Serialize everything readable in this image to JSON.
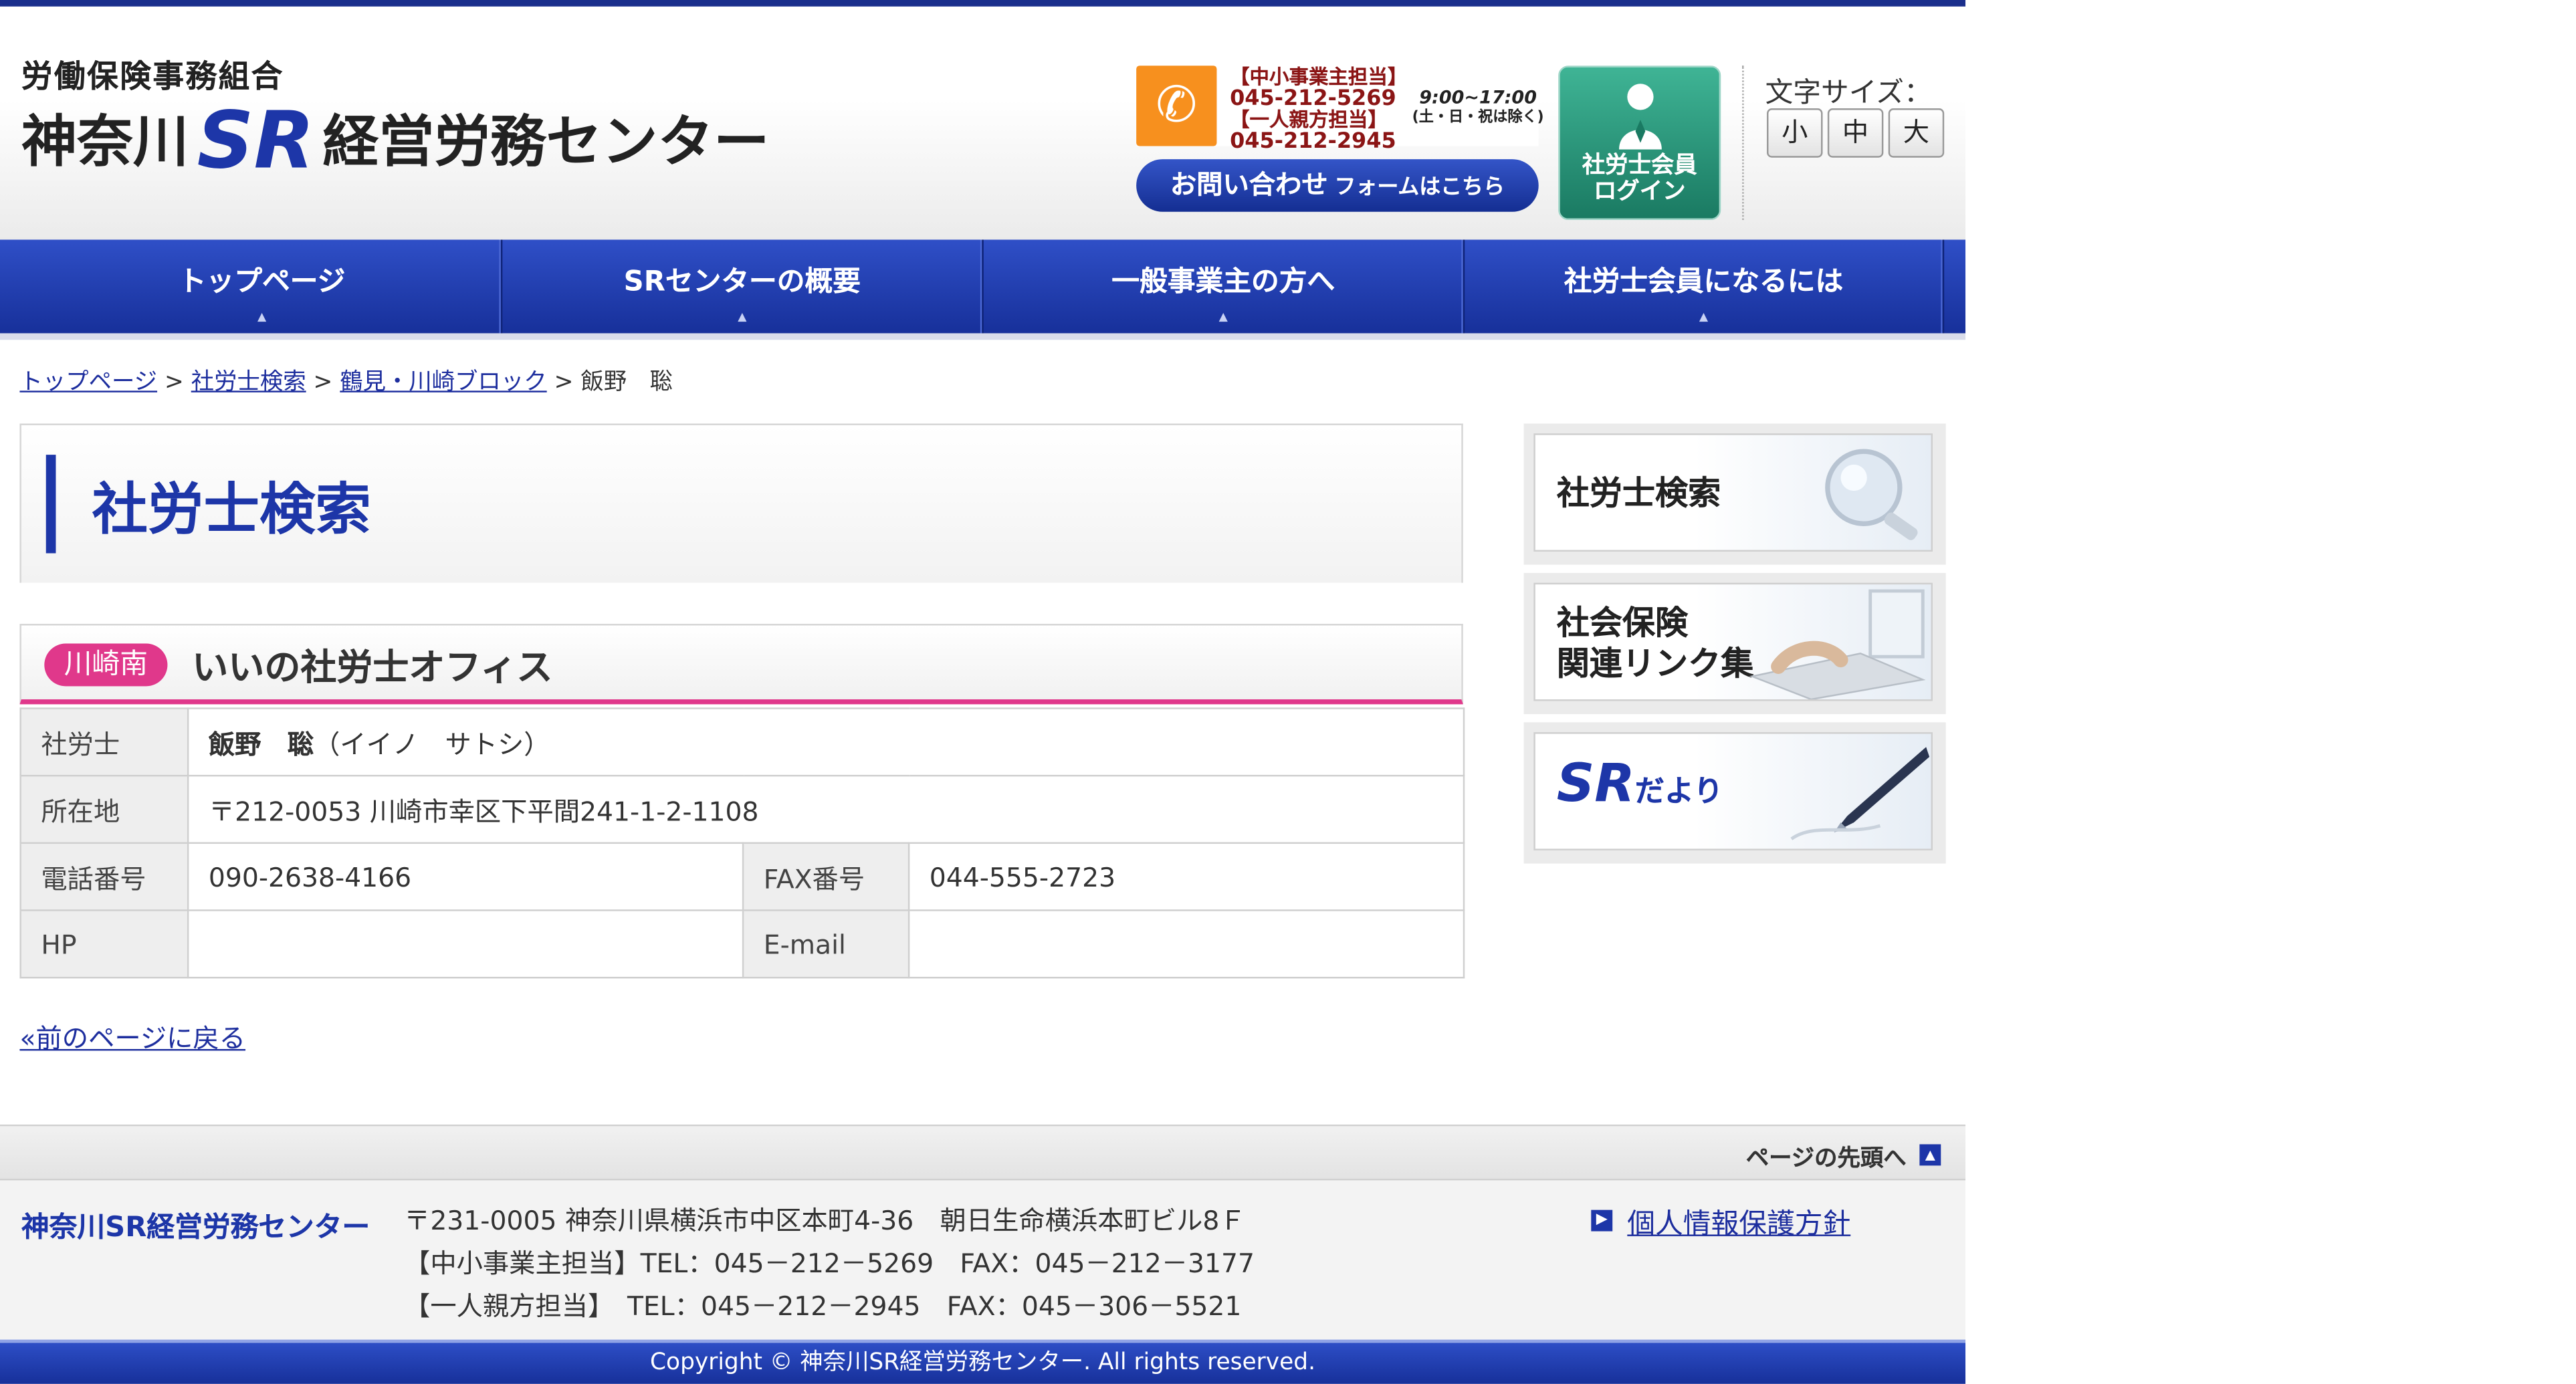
{
  "header": {
    "logo_small": "労働保険事務組合",
    "logo_main_prefix": "神奈川",
    "logo_main_sr": "SR",
    "logo_main_suffix": "経営労務センター",
    "tel": {
      "line1": "【中小事業主担当】",
      "number1": "045-212-5269",
      "line2": "【一人親方担当】",
      "number2": "045-212-2945",
      "hours": "9:00~17:00",
      "hours_note": "(土・日・祝は除く)"
    },
    "contact_button": "お問い合わせ",
    "contact_button_sub": "フォームはこちら",
    "login_line1": "社労士会員",
    "login_line2": "ログイン",
    "font_size_label": "文字サイズ：",
    "font_sizes": [
      "小",
      "中",
      "大"
    ]
  },
  "nav": [
    "トップページ",
    "SRセンターの概要",
    "一般事業主の方へ",
    "社労士会員になるには"
  ],
  "breadcrumb": {
    "items": [
      "トップページ",
      "社労士検索",
      "鶴見・川崎ブロック"
    ],
    "current": "飯野　聡",
    "separator": ">"
  },
  "main": {
    "heading": "社労士検索",
    "area_badge": "川崎南",
    "office_name": "いいの社労士オフィス",
    "table": {
      "labels": {
        "person": "社労士",
        "address": "所在地",
        "phone": "電話番号",
        "fax": "FAX番号",
        "hp": "HP",
        "email": "E-mail"
      },
      "name": "飯野　聡",
      "reading": "（イイノ　サトシ）",
      "address": "〒212-0053 川崎市幸区下平間241-1-2-1108",
      "phone": "090-2638-4166",
      "fax": "044-555-2723",
      "hp": "",
      "email": ""
    },
    "back_link": "«前のページに戻る"
  },
  "sidebar": {
    "search": "社労士検索",
    "links_line1": "社会保険",
    "links_line2": "関連リンク集",
    "newsletter_sr": "SR",
    "newsletter_rest": "だより"
  },
  "footer": {
    "pagetop": "ページの先頭へ",
    "org_name": "神奈川SR経営労務センター",
    "address_lines": [
      "〒231-0005 神奈川県横浜市中区本町4-36　朝日生命横浜本町ビル8Ｆ",
      "【中小事業主担当】TEL：045－212－5269　FAX：045－212－3177",
      "【一人親方担当】　TEL：045－212－2945　FAX：045－306－5521"
    ],
    "privacy": "個人情報保護方針",
    "copyright": "Copyright © 神奈川SR経営労務センター. All rights reserved."
  }
}
